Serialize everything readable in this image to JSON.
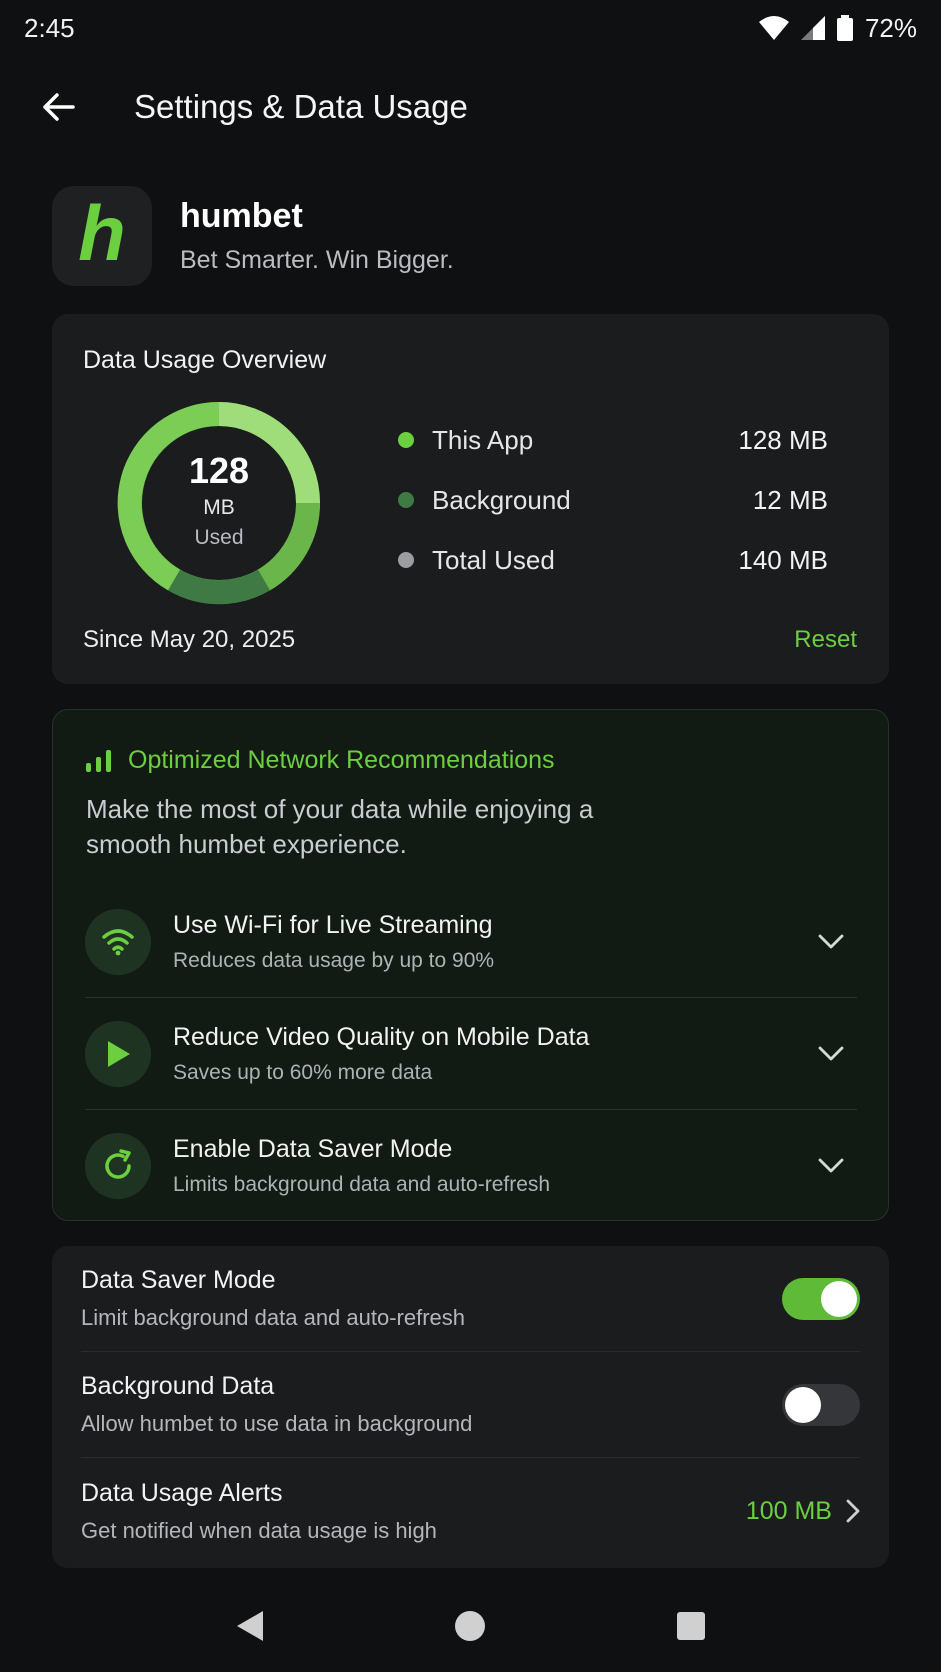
{
  "status_bar": {
    "time": "2:45",
    "battery": "72%"
  },
  "header": {
    "title": "Settings & Data Usage"
  },
  "app": {
    "logo_letter": "h",
    "name": "humbet",
    "tagline": "Bet Smarter. Win Bigger."
  },
  "usage": {
    "title": "Data Usage Overview",
    "center_value": "128",
    "center_unit": "MB",
    "center_label": "Used",
    "legend": [
      {
        "label": "This App",
        "value": "128 MB",
        "color": "#6ccf3f"
      },
      {
        "label": "Background",
        "value": "12 MB",
        "color": "#3f7a45"
      },
      {
        "label": "Total Used",
        "value": "140 MB",
        "color": "#9a9ca0"
      }
    ],
    "since": "Since May 20, 2025",
    "reset_label": "Reset"
  },
  "recommendations": {
    "title": "Optimized Network Recommendations",
    "description": "Make the most of your data while enjoying a smooth humbet experience.",
    "items": [
      {
        "icon": "wifi-icon",
        "title": "Use Wi-Fi for Live Streaming",
        "subtitle": "Reduces data usage by up to 90%"
      },
      {
        "icon": "play-icon",
        "title": "Reduce Video Quality on Mobile Data",
        "subtitle": "Saves up to 60% more data"
      },
      {
        "icon": "refresh-icon",
        "title": "Enable Data Saver Mode",
        "subtitle": "Limits background data and auto-refresh"
      }
    ]
  },
  "settings": {
    "data_saver": {
      "title": "Data Saver Mode",
      "subtitle": "Limit background data and auto-refresh",
      "enabled": true
    },
    "background_data": {
      "title": "Background Data",
      "subtitle": "Allow humbet to use data in background",
      "enabled": false
    },
    "alerts": {
      "title": "Data Usage Alerts",
      "subtitle": "Get notified when data usage is high",
      "value": "100 MB"
    }
  },
  "colors": {
    "accent": "#6ccf3f",
    "background": "#0f1011",
    "card": "#1b1c1e"
  }
}
